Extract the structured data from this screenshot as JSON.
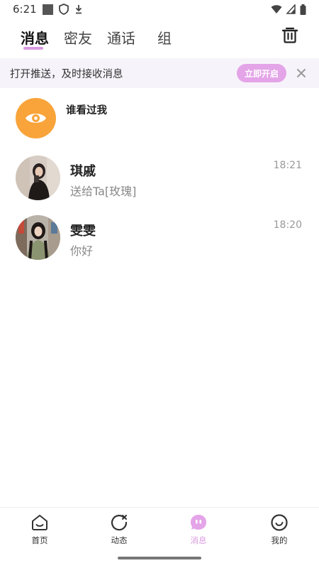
{
  "status_bar": {
    "time": "6:21"
  },
  "tabs": [
    {
      "label": "消息",
      "active": true
    },
    {
      "label": "密友",
      "active": false
    },
    {
      "label": "通话",
      "active": false
    },
    {
      "label": "组",
      "active": false
    }
  ],
  "push_banner": {
    "text": "打开推送，及时接收消息",
    "enable_label": "立即开启"
  },
  "viewed_me": {
    "title": "谁看过我"
  },
  "conversations": [
    {
      "name": "琪戚",
      "last_message": "送给Ta[玫瑰]",
      "time": "18:21"
    },
    {
      "name": "雯雯",
      "last_message": "你好",
      "time": "18:20"
    }
  ],
  "bottom_nav": [
    {
      "label": "首页",
      "icon": "home-icon",
      "active": false
    },
    {
      "label": "动态",
      "icon": "moments-icon",
      "active": false
    },
    {
      "label": "消息",
      "icon": "message-icon",
      "active": true
    },
    {
      "label": "我的",
      "icon": "profile-icon",
      "active": false
    }
  ],
  "colors": {
    "accent": "#d99ae0",
    "push_button": "#e4a4e8",
    "viewed_avatar": "#f8a43a",
    "banner_bg": "#f7f3fa"
  }
}
